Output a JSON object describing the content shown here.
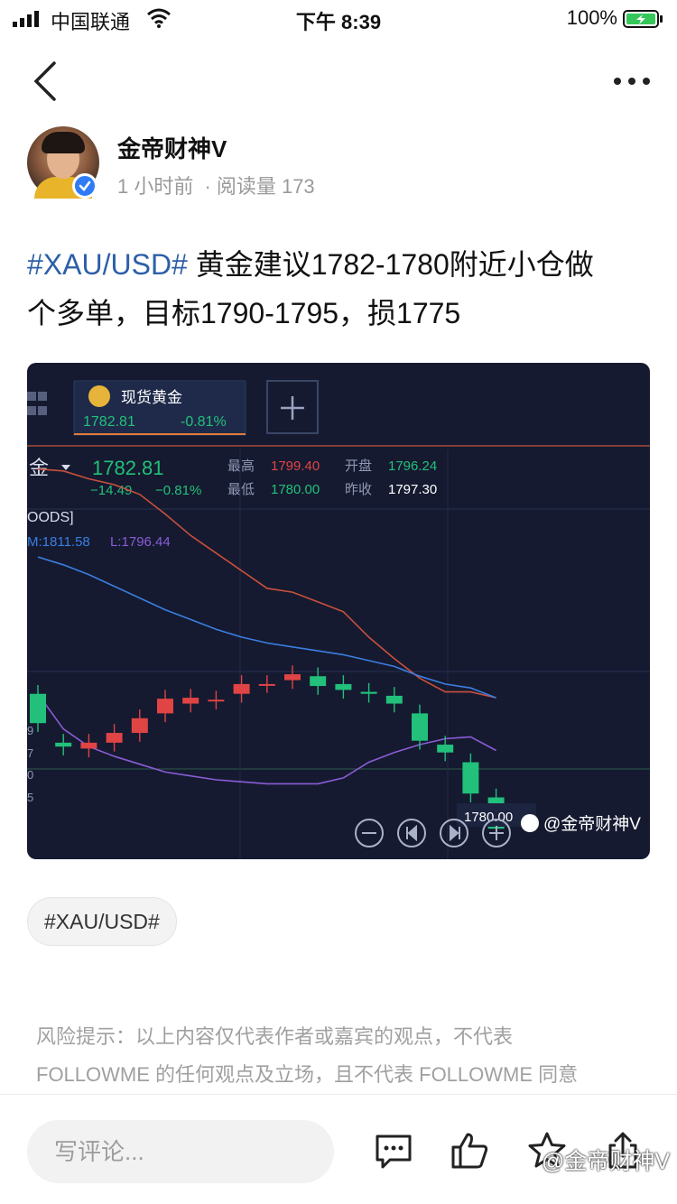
{
  "status_bar": {
    "carrier": "中国联通",
    "time": "下午 8:39",
    "battery": "100%"
  },
  "author": {
    "name": "金帝财神V",
    "time_ago": "1 小时前",
    "separator": "·",
    "reads_label": "阅读量",
    "reads": "173"
  },
  "post": {
    "hashtag": "#XAU/USD#",
    "body_line1": " 黄金建议1782-1780附近小仓做",
    "body_line2": "个多单，目标1790-1795，损1775"
  },
  "chart": {
    "tab_title": "现货黄金",
    "tab_price": "1782.81",
    "tab_change": "-0.81%",
    "instrument_label": "金",
    "price": "1782.81",
    "change": "−14.49",
    "change_pct": "−0.81%",
    "high_label": "最高",
    "high": "1799.40",
    "open_label": "开盘",
    "open": "1796.24",
    "low_label": "最低",
    "low": "1780.00",
    "prev_close_label": "昨收",
    "prev_close": "1797.30",
    "symbol_partial": "OODS]",
    "band_mid_partial": "M:1811.58",
    "band_lower": "L:1796.44",
    "axis_ticks": [
      "9",
      "7",
      "0",
      "5"
    ],
    "last_price_label": "1780.00",
    "image_watermark": "@金帝财神V",
    "colors": {
      "up": "#e04444",
      "down": "#22c07a",
      "upper_band": "#c9503c",
      "mid_band": "#3b7ee0",
      "lower_band": "#8a5cd6",
      "background": "#151a30"
    }
  },
  "chart_data": {
    "type": "candlestick",
    "title": "现货黄金",
    "candles": [
      {
        "o": 1789.0,
        "c": 1786.0
      },
      {
        "o": 1784.0,
        "c": 1783.6
      },
      {
        "o": 1783.4,
        "c": 1784.0
      },
      {
        "o": 1784.0,
        "c": 1785.0
      },
      {
        "o": 1785.0,
        "c": 1786.5
      },
      {
        "o": 1787.0,
        "c": 1788.5
      },
      {
        "o": 1788.0,
        "c": 1788.6
      },
      {
        "o": 1788.3,
        "c": 1788.4
      },
      {
        "o": 1789.0,
        "c": 1790.0
      },
      {
        "o": 1790.0,
        "c": 1790.0
      },
      {
        "o": 1790.4,
        "c": 1791.0
      },
      {
        "o": 1790.8,
        "c": 1789.8
      },
      {
        "o": 1790.0,
        "c": 1789.4
      },
      {
        "o": 1789.2,
        "c": 1789.0
      },
      {
        "o": 1788.8,
        "c": 1788.0
      },
      {
        "o": 1787.0,
        "c": 1784.2
      },
      {
        "o": 1783.8,
        "c": 1783.0
      },
      {
        "o": 1782.0,
        "c": 1778.8
      },
      {
        "o": 1778.4,
        "c": 1775.2
      }
    ],
    "upper_band": [
      1812.0,
      1811.8,
      1811.0,
      1810.4,
      1809.4,
      1807.4,
      1805.2,
      1803.4,
      1801.6,
      1799.8,
      1799.4,
      1798.4,
      1797.4,
      1794.8,
      1792.6,
      1790.6,
      1789.2,
      1789.2,
      1788.6
    ],
    "mid_band": [
      1803.0,
      1802.2,
      1801.2,
      1800.0,
      1798.8,
      1797.6,
      1796.6,
      1795.6,
      1794.8,
      1794.2,
      1793.8,
      1793.4,
      1793.0,
      1792.4,
      1791.8,
      1790.8,
      1790.0,
      1789.6,
      1788.6
    ],
    "lower_band": [
      1789.0,
      1785.4,
      1783.6,
      1782.6,
      1781.8,
      1781.0,
      1780.6,
      1780.2,
      1780.0,
      1779.8,
      1779.8,
      1779.8,
      1780.4,
      1782.0,
      1783.0,
      1783.8,
      1784.4,
      1784.6,
      1783.2
    ],
    "ylim": [
      1773,
      1814
    ]
  },
  "tag": "#XAU/USD#",
  "risk": {
    "line1": "风险提示：以上内容仅代表作者或嘉宾的观点，不代表",
    "line2": "FOLLOWME 的任何观点及立场，且不代表 FOLLOWME 同意"
  },
  "bottom": {
    "comment_placeholder": "写评论...",
    "watermark": "@金帝财神V"
  },
  "icons": {
    "back": "chevron-left-icon",
    "more": "more-dots-icon",
    "comment": "comment-icon",
    "like": "thumbs-up-icon",
    "favorite": "star-icon",
    "share": "share-icon"
  }
}
